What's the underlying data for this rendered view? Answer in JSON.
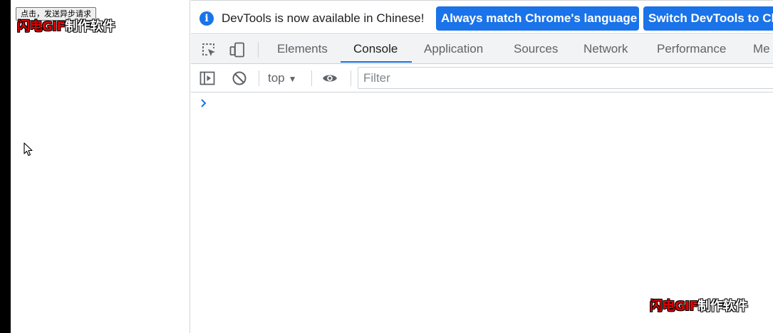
{
  "page": {
    "button_label": "点击，发送异步请求"
  },
  "watermark": {
    "red_part": "闪电GIF",
    "white_part": "制作软件"
  },
  "infobar": {
    "message": "DevTools is now available in Chinese!",
    "match_button": "Always match Chrome's language",
    "switch_button": "Switch DevTools to Chinese"
  },
  "tabs": [
    {
      "label": "Elements"
    },
    {
      "label": "Console"
    },
    {
      "label": "Application"
    },
    {
      "label": "Sources"
    },
    {
      "label": "Network"
    },
    {
      "label": "Performance"
    },
    {
      "label": "Me"
    }
  ],
  "active_tab": "Console",
  "toolbar": {
    "context_value": "top",
    "filter_placeholder": "Filter",
    "filter_value": ""
  },
  "colors": {
    "accent": "#1a73e8",
    "tab_text": "#5f6368",
    "watermark_red": "#e00000"
  },
  "icons": [
    "info-icon",
    "inspect-element-icon",
    "device-toggle-icon",
    "sidebar-toggle-icon",
    "clear-console-icon",
    "dropdown-arrow-icon",
    "eye-icon",
    "console-prompt-icon",
    "mouse-cursor-icon"
  ]
}
